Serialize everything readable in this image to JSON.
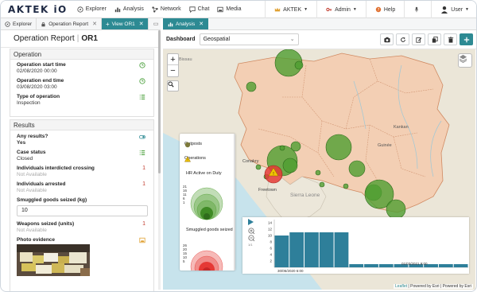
{
  "brand": "AKTEK iO",
  "nav": {
    "items": [
      {
        "label": "Explorer",
        "icon": "compass-icon"
      },
      {
        "label": "Analysis",
        "icon": "bar-chart-icon"
      },
      {
        "label": "Network",
        "icon": "network-icon"
      },
      {
        "label": "Chat",
        "icon": "chat-icon"
      },
      {
        "label": "Media",
        "icon": "image-icon"
      }
    ],
    "org": "AKTEK",
    "admin": "Admin",
    "help": "Help",
    "user": "User"
  },
  "left_tabs": [
    {
      "label": "Explorer"
    },
    {
      "label": "Operation Report"
    },
    {
      "label": "View OR1"
    }
  ],
  "report": {
    "title": "Operation Report",
    "id": "OR1",
    "operation": {
      "title": "Operation",
      "start_label": "Operation start time",
      "start_value": "02/08/2020 00:00",
      "end_label": "Operation end time",
      "end_value": "03/08/2020 03:00",
      "type_label": "Type of operation",
      "type_value": "Inspection"
    },
    "results": {
      "title": "Results",
      "any_results_label": "Any results?",
      "any_results_value": "Yes",
      "case_status_label": "Case status",
      "case_status_value": "Closed",
      "interdicted_label": "Individuals interdicted crossing",
      "interdicted_value": "Not Available",
      "interdicted_count": "1",
      "arrested_label": "Individuals arrested",
      "arrested_value": "Not Available",
      "arrested_count": "1",
      "smuggled_label": "Smuggled goods seized (kg)",
      "smuggled_value": "10",
      "weapons_label": "Weapons seized (units)",
      "weapons_value": "Not Available",
      "weapons_count": "1",
      "photo_label": "Photo evidence"
    }
  },
  "right_tab": {
    "label": "Analysis"
  },
  "toolbar": {
    "dashboard_label": "Dashboard",
    "dashboard_value": "Geospatial"
  },
  "map": {
    "zoom_in": "+",
    "zoom_out": "−",
    "place_labels": [
      "Bissau",
      "Guinée",
      "Kankan",
      "Conakry",
      "Freetown",
      "Sierra Leone"
    ],
    "legend": {
      "outposts": "Outposts",
      "operations": "Operations",
      "hr_title": "HR Active on Duty",
      "hr_ticks": [
        "21",
        "16",
        "11",
        "6",
        "1"
      ],
      "smuggled_title": "Smuggled goods seized",
      "smuggled_ticks": [
        "26",
        "20",
        "15",
        "10",
        "5"
      ]
    },
    "attribution": {
      "leaflet": "Leaflet",
      "esri1": "Powered by Esri",
      "esri2": "Powered by Esri"
    }
  },
  "chart_data": {
    "type": "bar",
    "yticks": [
      "14",
      "12",
      "10",
      "8",
      "6",
      "4",
      "2"
    ],
    "ylim": [
      0,
      14
    ],
    "values": [
      10,
      11,
      11,
      11,
      11,
      1,
      1,
      1,
      1,
      1,
      1,
      1,
      1
    ],
    "x_start_label": "30/06/2020 6:00",
    "x_end_label": "01/03/2021 9:00",
    "page": "1/1"
  },
  "colors": {
    "accent": "#2d8a93",
    "bar": "#2e7f9a",
    "outpost": "#3f9a2f",
    "operation": "#e53935",
    "land": "#f3cfb4"
  }
}
